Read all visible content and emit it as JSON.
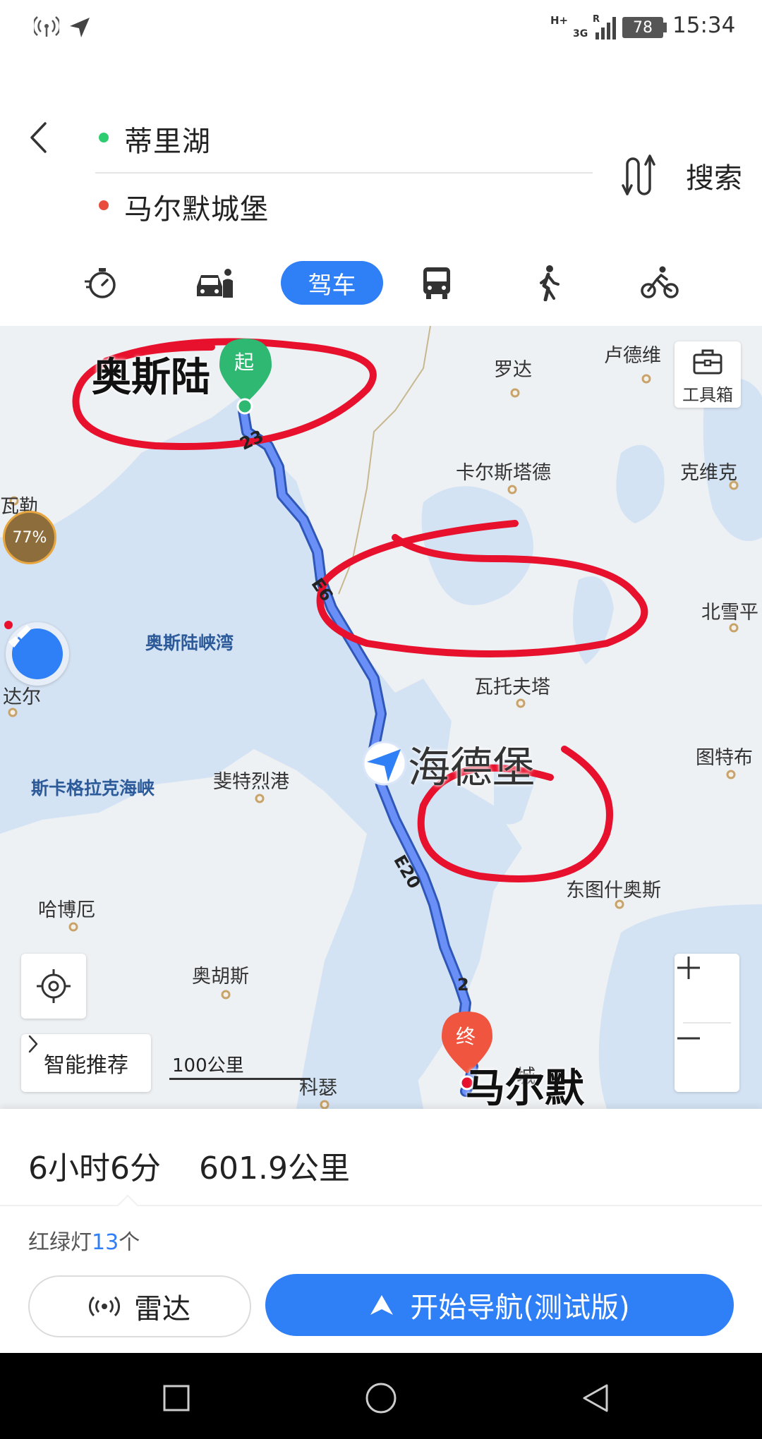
{
  "status_bar": {
    "network_1": "H+",
    "network_2": "3G",
    "roaming": "R",
    "battery": "78",
    "time": "15:34",
    "icons": [
      "wireless-icon",
      "location-arrow-icon",
      "signal-icon",
      "battery-icon"
    ]
  },
  "route": {
    "origin": "蒂里湖",
    "destination": "马尔默城堡",
    "search_label": "搜索",
    "origin_dot_color": "#2ecc71",
    "destination_dot_color": "#e74c3c"
  },
  "modes": {
    "active_label": "驾车",
    "items": [
      "stopwatch-icon",
      "taxi-icon",
      "drive-tab",
      "bus-icon",
      "walk-icon",
      "bike-icon"
    ]
  },
  "map": {
    "toolbox_label": "工具箱",
    "start_pin": "起",
    "end_pin": "终",
    "progress_badge": "77%",
    "route_numbers": [
      "23",
      "E6",
      "E20",
      "2"
    ],
    "scale_label": "100公里",
    "smart_recommend_label": "智能推荐",
    "places": [
      "卢德维",
      "罗达",
      "卡尔斯塔德",
      "克维克",
      "瓦勒",
      "北雪平",
      "瓦托夫塔",
      "达尔",
      "图特布",
      "斐特烈港",
      "东图什奥斯",
      "哈博厄",
      "奥胡斯",
      "科瑟",
      "城"
    ],
    "waters": [
      "奥斯陆峡湾",
      "斯卡格拉克海峡"
    ],
    "annotations": {
      "oslo": "奥斯陆",
      "heidelberg": "海德堡",
      "malmo": "马尔默"
    },
    "route_color": "#4d7cf5",
    "annotation_circle_color": "#e8112d"
  },
  "trip": {
    "duration": "6小时6分",
    "distance": "601.9公里",
    "traffic_lights_label": "红绿灯",
    "traffic_lights_count": "13",
    "traffic_lights_unit": "个"
  },
  "actions": {
    "radar_label": "雷达",
    "navigate_label": "开始导航(测试版)"
  }
}
